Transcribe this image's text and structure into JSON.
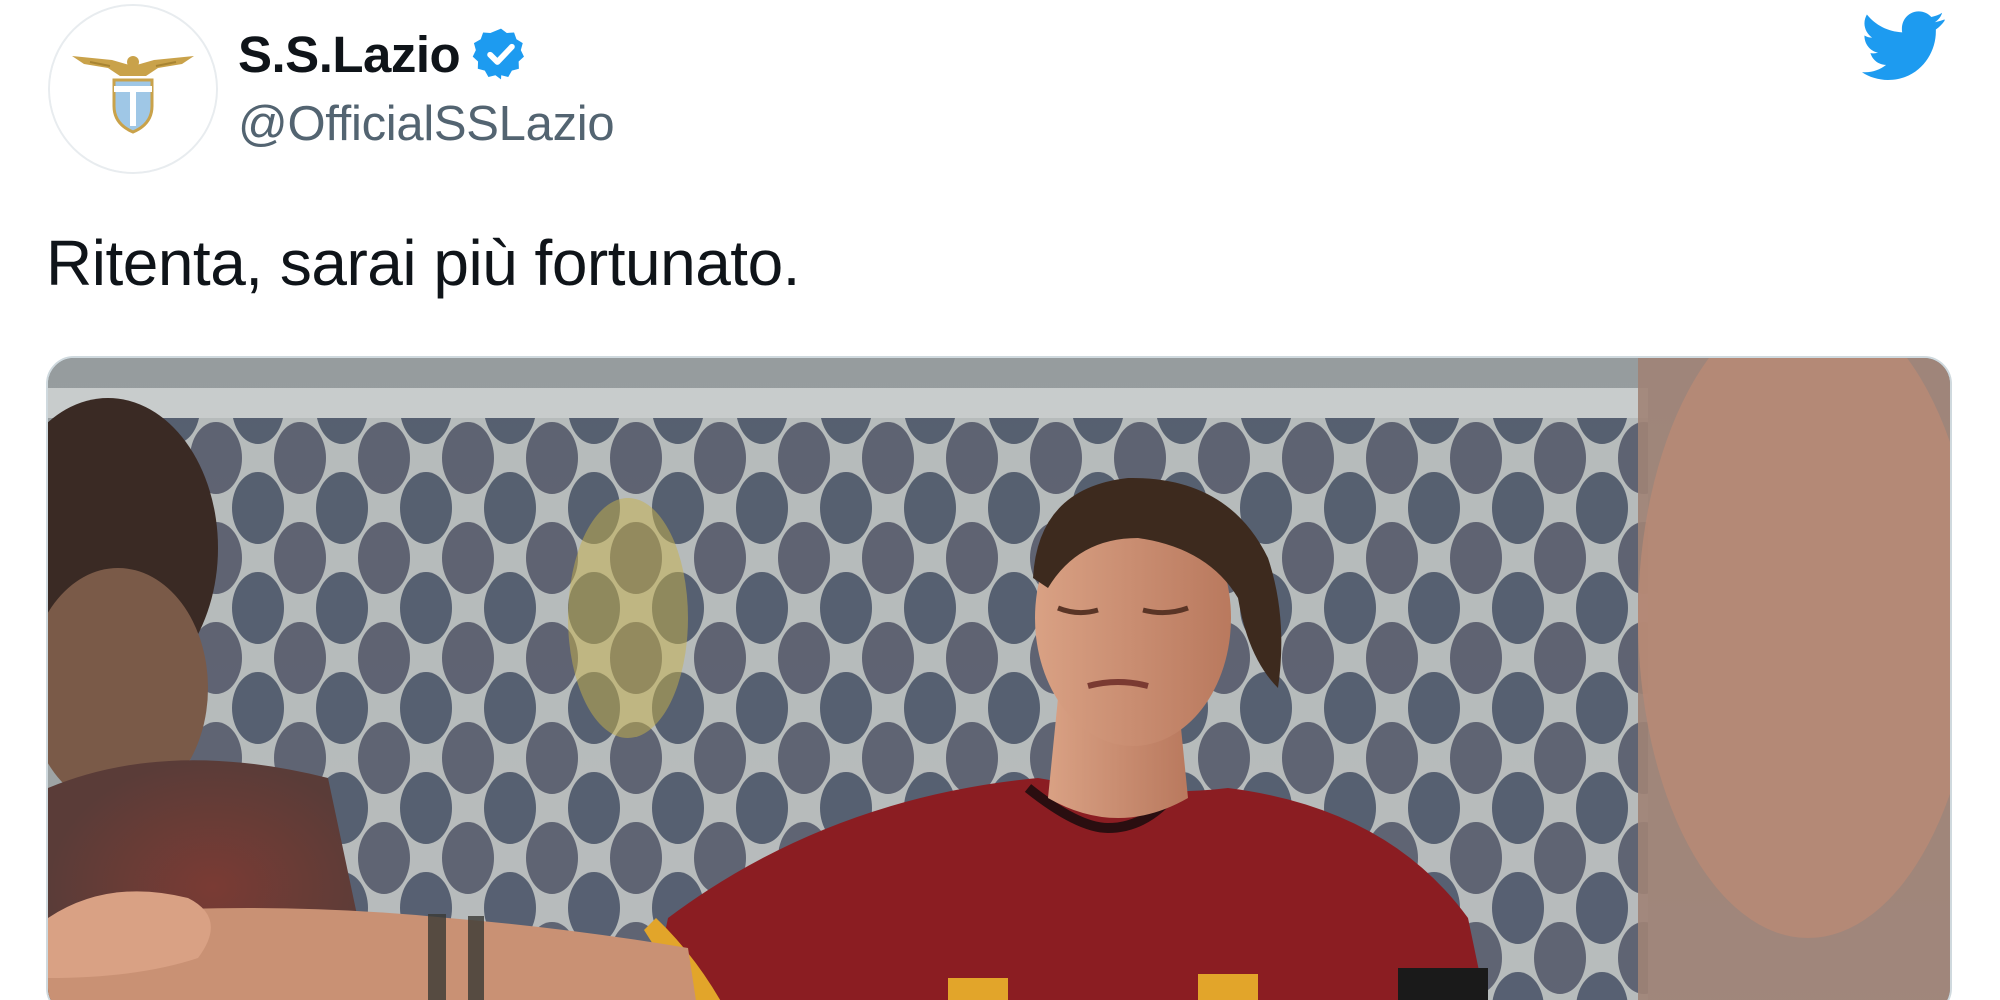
{
  "tweet": {
    "author": {
      "display_name": "S.S.Lazio",
      "handle": "@OfficialSSLazio",
      "verified": true,
      "avatar_icon": "lazio-eagle-crest-icon"
    },
    "platform_icon": "twitter-bird-icon",
    "text": "Ritenta, sarai più fortunato.",
    "media": {
      "type": "photo",
      "description_icon": "football-player-photo"
    }
  },
  "colors": {
    "twitter_blue": "#1d9bf0",
    "text_primary": "#0f1419",
    "text_secondary": "#536471",
    "jersey": "#8b1d22"
  }
}
